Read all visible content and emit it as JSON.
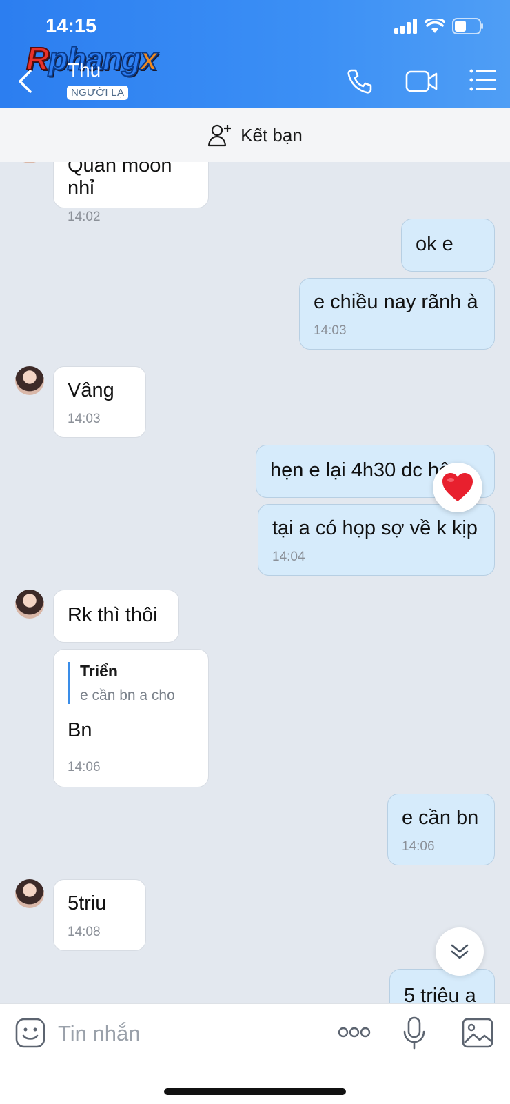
{
  "status_bar": {
    "time": "14:15"
  },
  "watermark": {
    "text_r": "R",
    "text_main": "phang",
    "text_x": "x"
  },
  "header": {
    "contact_name": "Thu",
    "badge": "NGƯỜI LẠ",
    "icons": [
      "back-chevron-icon",
      "phone-icon",
      "video-call-icon",
      "menu-list-icon"
    ]
  },
  "friend_bar": {
    "label": "Kết bạn",
    "icon": "add-friend-icon"
  },
  "messages": [
    {
      "side": "in",
      "text": "Quán mòón nhỉ",
      "time": "14:02"
    },
    {
      "side": "out",
      "text": "ok e",
      "time": ""
    },
    {
      "side": "out",
      "text": "e chiều nay rãnh à",
      "time": "14:03"
    },
    {
      "side": "in",
      "text": "Vâng",
      "time": "14:03"
    },
    {
      "side": "out",
      "text": "hẹn e lại 4h30 dc hô",
      "time": "",
      "reaction": "heart"
    },
    {
      "side": "out",
      "text": "tại a có họp sợ về k kịp",
      "time": "14:04"
    },
    {
      "side": "in",
      "text": "Rk thì thôi",
      "time": ""
    },
    {
      "side": "in",
      "text": "Bn",
      "time": "14:06",
      "quote": {
        "name": "Triển",
        "text": "e cần bn a cho"
      }
    },
    {
      "side": "out",
      "text": "e cần bn",
      "time": "14:06"
    },
    {
      "side": "in",
      "text": "5triu",
      "time": "14:08"
    },
    {
      "side": "out",
      "text": "5 triệu a",
      "time": ""
    }
  ],
  "input": {
    "placeholder": "Tin nhắn",
    "icons": [
      "sticker-icon",
      "more-icon",
      "microphone-icon",
      "image-icon"
    ]
  },
  "colors": {
    "header": "#2c7ef0",
    "out_bubble": "#d6ebfb",
    "in_bubble": "#ffffff",
    "background": "#e3e8ef"
  }
}
